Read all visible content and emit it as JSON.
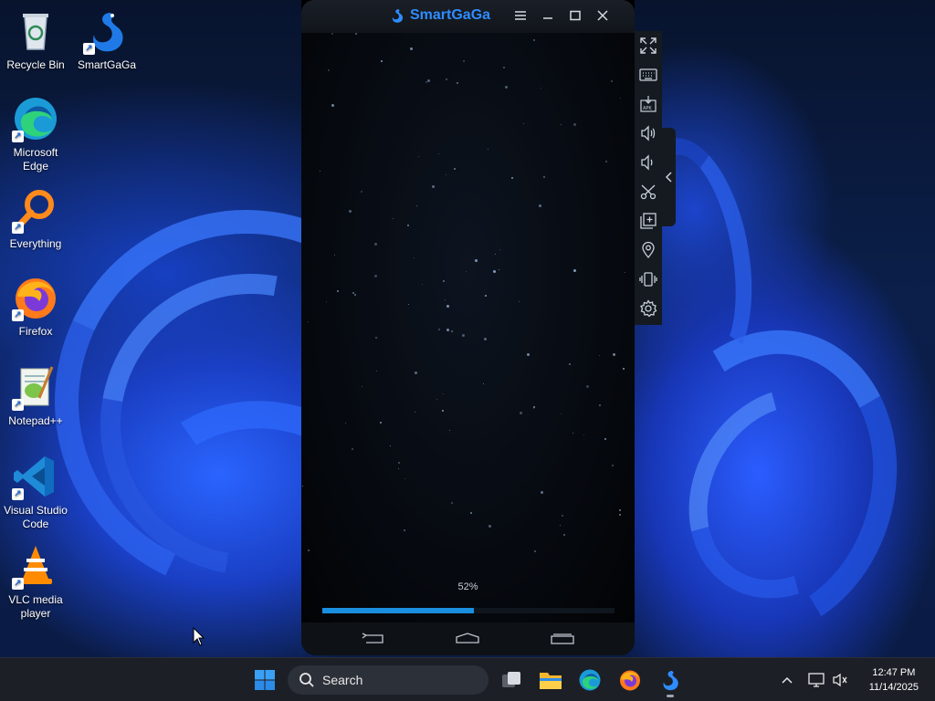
{
  "desktop": {
    "icons": [
      {
        "label": "Recycle Bin",
        "icon": "recycle-bin-icon"
      },
      {
        "label": "SmartGaGa",
        "icon": "smartgaga-icon"
      },
      {
        "label": "Microsoft Edge",
        "icon": "edge-icon"
      },
      {
        "label": "Everything",
        "icon": "everything-icon"
      },
      {
        "label": "Firefox",
        "icon": "firefox-icon"
      },
      {
        "label": "Notepad++",
        "icon": "notepadpp-icon"
      },
      {
        "label": "Visual Studio Code",
        "icon": "vscode-icon"
      },
      {
        "label": "VLC media player",
        "icon": "vlc-icon"
      }
    ]
  },
  "emulator": {
    "title": "SmartGaGa",
    "title_controls": [
      "menu-icon",
      "minimize-icon",
      "maximize-icon",
      "close-icon"
    ],
    "loading_percent_label": "52%",
    "loading_progress": 0.52,
    "nav_buttons": [
      "back-icon",
      "home-icon",
      "recents-icon"
    ],
    "toolbar": [
      "fullscreen-icon",
      "keyboard-icon",
      "apk-install-icon",
      "volume-up-icon",
      "volume-down-icon",
      "screenshot-scissors-icon",
      "multi-instance-icon",
      "location-icon",
      "shake-icon",
      "settings-icon"
    ],
    "toolbar_collapse": "chevron-left-icon"
  },
  "taskbar": {
    "search_placeholder": "Search",
    "apps": [
      "start-icon",
      "task-view-icon",
      "file-explorer-icon",
      "edge-icon",
      "firefox-icon",
      "smartgaga-icon"
    ],
    "tray": [
      "chevron-up-icon",
      "network-icon",
      "volume-muted-icon"
    ],
    "time": "12:47 PM",
    "date": "11/14/2025"
  },
  "colors": {
    "accent": "#2f8cff",
    "progress": "#1a8fe0",
    "taskbar": "#1c1f26"
  }
}
